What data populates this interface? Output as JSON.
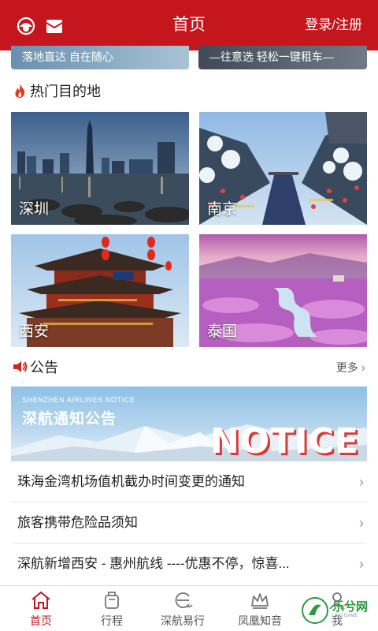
{
  "header": {
    "title": "首页",
    "login_label": "登录/注册",
    "icons": [
      "customer-service-icon",
      "mail-icon"
    ],
    "accent_color": "#c5161d"
  },
  "top_banners": [
    {
      "text": "落地直达 自在随心"
    },
    {
      "text": "—往意选 轻松一键租车—"
    }
  ],
  "hot_destinations": {
    "title": "热门目的地",
    "icon": "flame-icon",
    "items": [
      {
        "label": "深圳"
      },
      {
        "label": "南京"
      },
      {
        "label": "西安"
      },
      {
        "label": "泰国"
      }
    ]
  },
  "announcements": {
    "title": "公告",
    "icon": "speaker-icon",
    "more_label": "更多",
    "banner": {
      "subtitle": "SHENZHEN AIRLINES NOTICE",
      "title": "深航通知公告",
      "big_text": "NOTICE"
    },
    "items": [
      {
        "text": "珠海金湾机场值机截办时间变更的通知"
      },
      {
        "text": "旅客携带危险品须知"
      },
      {
        "text": "深航新增西安 - 惠州航线 ----优惠不停，惊喜..."
      }
    ]
  },
  "tabbar": {
    "items": [
      {
        "label": "首页",
        "icon": "home-icon",
        "active": true
      },
      {
        "label": "行程",
        "icon": "luggage-icon",
        "active": false
      },
      {
        "label": "深航易行",
        "icon": "easy-travel-icon",
        "active": false
      },
      {
        "label": "凤凰知音",
        "icon": "crown-icon",
        "active": false
      },
      {
        "label": "我",
        "icon": "user-icon",
        "active": false
      }
    ]
  },
  "watermark": {
    "text": "乐兮网",
    "sub": "LEXI GAME"
  }
}
